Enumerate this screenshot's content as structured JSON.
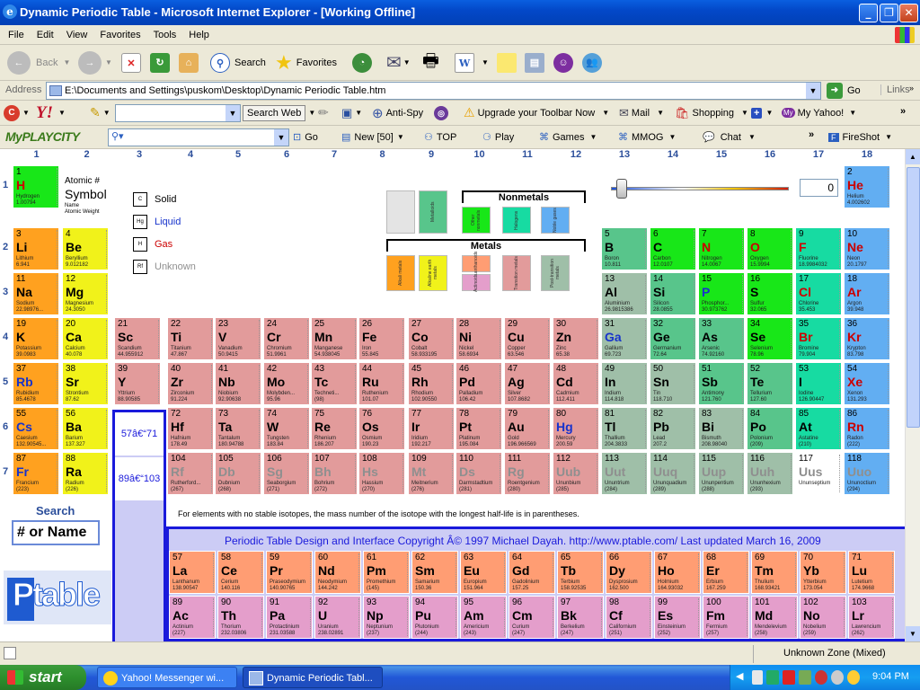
{
  "window": {
    "title": "Dynamic Periodic Table - Microsoft Internet Explorer - [Working Offline]"
  },
  "menu": [
    "File",
    "Edit",
    "View",
    "Favorites",
    "Tools",
    "Help"
  ],
  "toolbar": {
    "back": "Back",
    "search": "Search",
    "favorites": "Favorites"
  },
  "address": {
    "label": "Address",
    "value": "E:\\Documents and Settings\\puskom\\Desktop\\Dynamic Periodic Table.htm",
    "go": "Go",
    "links": "Links"
  },
  "yahoo_bar": {
    "search_web": "Search Web",
    "anti_spy": "Anti-Spy",
    "upgrade": "Upgrade your Toolbar Now",
    "mail": "Mail",
    "shopping": "Shopping",
    "my_yahoo": "My Yahoo!"
  },
  "myplaycity_bar": {
    "logo": "MyPLAYCITY",
    "go": "Go",
    "new": "New [50]",
    "top": "TOP",
    "play": "Play",
    "games": "Games",
    "mmog": "MMOG",
    "chat": "Chat",
    "fireshot": "FireShot"
  },
  "columns": [
    "1",
    "2",
    "3",
    "4",
    "5",
    "6",
    "7",
    "8",
    "9",
    "10",
    "11",
    "12",
    "13",
    "14",
    "15",
    "16",
    "17",
    "18"
  ],
  "rows": [
    "1",
    "2",
    "3",
    "4",
    "5",
    "6",
    "7"
  ],
  "key": {
    "atomic_no": "Atomic #",
    "symbol": "Symbol",
    "name": "Name",
    "weight": "Atomic Weight"
  },
  "states": [
    {
      "code": "C",
      "label": "Solid",
      "color": "#000000"
    },
    {
      "code": "Hg",
      "label": "Liquid",
      "color": "#1733cc"
    },
    {
      "code": "H",
      "label": "Gas",
      "color": "#cc0000"
    },
    {
      "code": "Rf",
      "label": "Unknown",
      "color": "#8f8f8f"
    }
  ],
  "categories": {
    "nonmetals": "Nonmetals",
    "metals": "Metals"
  },
  "temperature": {
    "value": "0"
  },
  "lanthanide_range": "57â€“71",
  "actinide_range": "89â€“103",
  "note": "For elements with no stable isotopes, the mass number of the isotope with the longest half-life is in parentheses.",
  "copyright": "Periodic Table Design and Interface Copyright Â© 1997 Michael Dayah. http://www.ptable.com/ Last updated March 16, 2009",
  "search": {
    "title": "Search",
    "placeholder": "# or Name"
  },
  "logo": {
    "big": "Ptable",
    ".com": ".com"
  },
  "statusbar": {
    "zone": "Unknown Zone (Mixed)"
  },
  "taskbar": {
    "start": "start",
    "tasks": [
      "Yahoo! Messenger wi...",
      "Dynamic Periodic Tabl..."
    ],
    "clock": "9:04 PM"
  },
  "elements": [
    {
      "n": 1,
      "s": "H",
      "name": "Hydrogen",
      "w": "1.00794",
      "c": "nm",
      "st": "gas",
      "col": 1,
      "row": 1
    },
    {
      "n": 2,
      "s": "He",
      "name": "Helium",
      "w": "4.002602",
      "c": "ng",
      "st": "gas",
      "col": 18,
      "row": 1
    },
    {
      "n": 3,
      "s": "Li",
      "name": "Lithium",
      "w": "6.941",
      "c": "alk",
      "st": "solid",
      "col": 1,
      "row": 2
    },
    {
      "n": 4,
      "s": "Be",
      "name": "Beryllium",
      "w": "9.012182",
      "c": "ae",
      "st": "solid",
      "col": 2,
      "row": 2
    },
    {
      "n": 5,
      "s": "B",
      "name": "Boron",
      "w": "10.811",
      "c": "met",
      "st": "solid",
      "col": 13,
      "row": 2
    },
    {
      "n": 6,
      "s": "C",
      "name": "Carbon",
      "w": "12.0107",
      "c": "nm",
      "st": "solid",
      "col": 14,
      "row": 2
    },
    {
      "n": 7,
      "s": "N",
      "name": "Nitrogen",
      "w": "14.0067",
      "c": "nm",
      "st": "gas",
      "col": 15,
      "row": 2
    },
    {
      "n": 8,
      "s": "O",
      "name": "Oxygen",
      "w": "15.9994",
      "c": "nm",
      "st": "gas",
      "col": 16,
      "row": 2
    },
    {
      "n": 9,
      "s": "F",
      "name": "Fluorine",
      "w": "18.9984032",
      "c": "hal",
      "st": "gas",
      "col": 17,
      "row": 2
    },
    {
      "n": 10,
      "s": "Ne",
      "name": "Neon",
      "w": "20.1797",
      "c": "ng",
      "st": "gas",
      "col": 18,
      "row": 2
    },
    {
      "n": 11,
      "s": "Na",
      "name": "Sodium",
      "w": "22.98976...",
      "c": "alk",
      "st": "solid",
      "col": 1,
      "row": 3
    },
    {
      "n": 12,
      "s": "Mg",
      "name": "Magnesium",
      "w": "24.3050",
      "c": "ae",
      "st": "solid",
      "col": 2,
      "row": 3
    },
    {
      "n": 13,
      "s": "Al",
      "name": "Aluminium",
      "w": "26.9815386",
      "c": "pt",
      "st": "solid",
      "col": 13,
      "row": 3
    },
    {
      "n": 14,
      "s": "Si",
      "name": "Silicon",
      "w": "28.0855",
      "c": "met",
      "st": "solid",
      "col": 14,
      "row": 3
    },
    {
      "n": 15,
      "s": "P",
      "name": "Phosphor...",
      "w": "30.973762",
      "c": "nm",
      "st": "liquid",
      "col": 15,
      "row": 3
    },
    {
      "n": 16,
      "s": "S",
      "name": "Sulfur",
      "w": "32.065",
      "c": "nm",
      "st": "solid",
      "col": 16,
      "row": 3
    },
    {
      "n": 17,
      "s": "Cl",
      "name": "Chlorine",
      "w": "35.453",
      "c": "hal",
      "st": "gas",
      "col": 17,
      "row": 3
    },
    {
      "n": 18,
      "s": "Ar",
      "name": "Argon",
      "w": "39.948",
      "c": "ng",
      "st": "gas",
      "col": 18,
      "row": 3
    },
    {
      "n": 19,
      "s": "K",
      "name": "Potassium",
      "w": "39.0983",
      "c": "alk",
      "st": "solid",
      "col": 1,
      "row": 4
    },
    {
      "n": 20,
      "s": "Ca",
      "name": "Calcium",
      "w": "40.078",
      "c": "ae",
      "st": "solid",
      "col": 2,
      "row": 4
    },
    {
      "n": 21,
      "s": "Sc",
      "name": "Scandium",
      "w": "44.955912",
      "c": "tm",
      "st": "solid",
      "col": 3,
      "row": 4
    },
    {
      "n": 22,
      "s": "Ti",
      "name": "Titanium",
      "w": "47.867",
      "c": "tm",
      "st": "solid",
      "col": 4,
      "row": 4
    },
    {
      "n": 23,
      "s": "V",
      "name": "Vanadium",
      "w": "50.9415",
      "c": "tm",
      "st": "solid",
      "col": 5,
      "row": 4
    },
    {
      "n": 24,
      "s": "Cr",
      "name": "Chromium",
      "w": "51.9961",
      "c": "tm",
      "st": "solid",
      "col": 6,
      "row": 4
    },
    {
      "n": 25,
      "s": "Mn",
      "name": "Manganese",
      "w": "54.938045",
      "c": "tm",
      "st": "solid",
      "col": 7,
      "row": 4
    },
    {
      "n": 26,
      "s": "Fe",
      "name": "Iron",
      "w": "55.845",
      "c": "tm",
      "st": "solid",
      "col": 8,
      "row": 4
    },
    {
      "n": 27,
      "s": "Co",
      "name": "Cobalt",
      "w": "58.933195",
      "c": "tm",
      "st": "solid",
      "col": 9,
      "row": 4
    },
    {
      "n": 28,
      "s": "Ni",
      "name": "Nickel",
      "w": "58.6934",
      "c": "tm",
      "st": "solid",
      "col": 10,
      "row": 4
    },
    {
      "n": 29,
      "s": "Cu",
      "name": "Copper",
      "w": "63.546",
      "c": "tm",
      "st": "solid",
      "col": 11,
      "row": 4
    },
    {
      "n": 30,
      "s": "Zn",
      "name": "Zinc",
      "w": "65.38",
      "c": "tm",
      "st": "solid",
      "col": 12,
      "row": 4
    },
    {
      "n": 31,
      "s": "Ga",
      "name": "Gallium",
      "w": "69.723",
      "c": "pt",
      "st": "liquid",
      "col": 13,
      "row": 4
    },
    {
      "n": 32,
      "s": "Ge",
      "name": "Germanium",
      "w": "72.64",
      "c": "met",
      "st": "solid",
      "col": 14,
      "row": 4
    },
    {
      "n": 33,
      "s": "As",
      "name": "Arsenic",
      "w": "74.92160",
      "c": "met",
      "st": "solid",
      "col": 15,
      "row": 4
    },
    {
      "n": 34,
      "s": "Se",
      "name": "Selenium",
      "w": "78.96",
      "c": "nm",
      "st": "solid",
      "col": 16,
      "row": 4
    },
    {
      "n": 35,
      "s": "Br",
      "name": "Bromine",
      "w": "79.904",
      "c": "hal",
      "st": "gas",
      "col": 17,
      "row": 4
    },
    {
      "n": 36,
      "s": "Kr",
      "name": "Krypton",
      "w": "83.798",
      "c": "ng",
      "st": "gas",
      "col": 18,
      "row": 4
    },
    {
      "n": 37,
      "s": "Rb",
      "name": "Rubidium",
      "w": "85.4678",
      "c": "alk",
      "st": "liquid",
      "col": 1,
      "row": 5
    },
    {
      "n": 38,
      "s": "Sr",
      "name": "Strontium",
      "w": "87.62",
      "c": "ae",
      "st": "solid",
      "col": 2,
      "row": 5
    },
    {
      "n": 39,
      "s": "Y",
      "name": "Yttrium",
      "w": "88.90585",
      "c": "tm",
      "st": "solid",
      "col": 3,
      "row": 5
    },
    {
      "n": 40,
      "s": "Zr",
      "name": "Zirconium",
      "w": "91.224",
      "c": "tm",
      "st": "solid",
      "col": 4,
      "row": 5
    },
    {
      "n": 41,
      "s": "Nb",
      "name": "Niobium",
      "w": "92.90638",
      "c": "tm",
      "st": "solid",
      "col": 5,
      "row": 5
    },
    {
      "n": 42,
      "s": "Mo",
      "name": "Molybden...",
      "w": "95.96",
      "c": "tm",
      "st": "solid",
      "col": 6,
      "row": 5
    },
    {
      "n": 43,
      "s": "Tc",
      "name": "Techneti...",
      "w": "(98)",
      "c": "tm",
      "st": "solid",
      "col": 7,
      "row": 5
    },
    {
      "n": 44,
      "s": "Ru",
      "name": "Ruthenium",
      "w": "101.07",
      "c": "tm",
      "st": "solid",
      "col": 8,
      "row": 5
    },
    {
      "n": 45,
      "s": "Rh",
      "name": "Rhodium",
      "w": "102.90550",
      "c": "tm",
      "st": "solid",
      "col": 9,
      "row": 5
    },
    {
      "n": 46,
      "s": "Pd",
      "name": "Palladium",
      "w": "106.42",
      "c": "tm",
      "st": "solid",
      "col": 10,
      "row": 5
    },
    {
      "n": 47,
      "s": "Ag",
      "name": "Silver",
      "w": "107.8682",
      "c": "tm",
      "st": "solid",
      "col": 11,
      "row": 5
    },
    {
      "n": 48,
      "s": "Cd",
      "name": "Cadmium",
      "w": "112.411",
      "c": "tm",
      "st": "solid",
      "col": 12,
      "row": 5
    },
    {
      "n": 49,
      "s": "In",
      "name": "Indium",
      "w": "114.818",
      "c": "pt",
      "st": "solid",
      "col": 13,
      "row": 5
    },
    {
      "n": 50,
      "s": "Sn",
      "name": "Tin",
      "w": "118.710",
      "c": "pt",
      "st": "solid",
      "col": 14,
      "row": 5
    },
    {
      "n": 51,
      "s": "Sb",
      "name": "Antimony",
      "w": "121.760",
      "c": "met",
      "st": "solid",
      "col": 15,
      "row": 5
    },
    {
      "n": 52,
      "s": "Te",
      "name": "Tellurium",
      "w": "127.60",
      "c": "met",
      "st": "solid",
      "col": 16,
      "row": 5
    },
    {
      "n": 53,
      "s": "I",
      "name": "Iodine",
      "w": "126.90447",
      "c": "hal",
      "st": "solid",
      "col": 17,
      "row": 5
    },
    {
      "n": 54,
      "s": "Xe",
      "name": "Xenon",
      "w": "131.293",
      "c": "ng",
      "st": "gas",
      "col": 18,
      "row": 5
    },
    {
      "n": 55,
      "s": "Cs",
      "name": "Caesium",
      "w": "132.90545...",
      "c": "alk",
      "st": "liquid",
      "col": 1,
      "row": 6
    },
    {
      "n": 56,
      "s": "Ba",
      "name": "Barium",
      "w": "137.327",
      "c": "ae",
      "st": "solid",
      "col": 2,
      "row": 6
    },
    {
      "n": 72,
      "s": "Hf",
      "name": "Hafnium",
      "w": "178.49",
      "c": "tm",
      "st": "solid",
      "col": 4,
      "row": 6
    },
    {
      "n": 73,
      "s": "Ta",
      "name": "Tantalum",
      "w": "180.94788",
      "c": "tm",
      "st": "solid",
      "col": 5,
      "row": 6
    },
    {
      "n": 74,
      "s": "W",
      "name": "Tungsten",
      "w": "183.84",
      "c": "tm",
      "st": "solid",
      "col": 6,
      "row": 6
    },
    {
      "n": 75,
      "s": "Re",
      "name": "Rhenium",
      "w": "186.207",
      "c": "tm",
      "st": "solid",
      "col": 7,
      "row": 6
    },
    {
      "n": 76,
      "s": "Os",
      "name": "Osmium",
      "w": "190.23",
      "c": "tm",
      "st": "solid",
      "col": 8,
      "row": 6
    },
    {
      "n": 77,
      "s": "Ir",
      "name": "Iridium",
      "w": "192.217",
      "c": "tm",
      "st": "solid",
      "col": 9,
      "row": 6
    },
    {
      "n": 78,
      "s": "Pt",
      "name": "Platinum",
      "w": "195.084",
      "c": "tm",
      "st": "solid",
      "col": 10,
      "row": 6
    },
    {
      "n": 79,
      "s": "Au",
      "name": "Gold",
      "w": "196.966569",
      "c": "tm",
      "st": "solid",
      "col": 11,
      "row": 6
    },
    {
      "n": 80,
      "s": "Hg",
      "name": "Mercury",
      "w": "200.59",
      "c": "tm",
      "st": "liquid",
      "col": 12,
      "row": 6
    },
    {
      "n": 81,
      "s": "Tl",
      "name": "Thallium",
      "w": "204.3833",
      "c": "pt",
      "st": "solid",
      "col": 13,
      "row": 6
    },
    {
      "n": 82,
      "s": "Pb",
      "name": "Lead",
      "w": "207.2",
      "c": "pt",
      "st": "solid",
      "col": 14,
      "row": 6
    },
    {
      "n": 83,
      "s": "Bi",
      "name": "Bismuth",
      "w": "208.98040",
      "c": "pt",
      "st": "solid",
      "col": 15,
      "row": 6
    },
    {
      "n": 84,
      "s": "Po",
      "name": "Polonium",
      "w": "(209)",
      "c": "met",
      "st": "solid",
      "col": 16,
      "row": 6
    },
    {
      "n": 85,
      "s": "At",
      "name": "Astatine",
      "w": "(210)",
      "c": "hal",
      "st": "solid",
      "col": 17,
      "row": 6
    },
    {
      "n": 86,
      "s": "Rn",
      "name": "Radon",
      "w": "(222)",
      "c": "ng",
      "st": "gas",
      "col": 18,
      "row": 6
    },
    {
      "n": 87,
      "s": "Fr",
      "name": "Francium",
      "w": "(223)",
      "c": "alk",
      "st": "liquid",
      "col": 1,
      "row": 7
    },
    {
      "n": 88,
      "s": "Ra",
      "name": "Radium",
      "w": "(226)",
      "c": "ae",
      "st": "solid",
      "col": 2,
      "row": 7
    },
    {
      "n": 104,
      "s": "Rf",
      "name": "Rutherford...",
      "w": "(267)",
      "c": "tm",
      "st": "unknown",
      "col": 4,
      "row": 7
    },
    {
      "n": 105,
      "s": "Db",
      "name": "Dubnium",
      "w": "(268)",
      "c": "tm",
      "st": "unknown",
      "col": 5,
      "row": 7
    },
    {
      "n": 106,
      "s": "Sg",
      "name": "Seaborgium",
      "w": "(271)",
      "c": "tm",
      "st": "unknown",
      "col": 6,
      "row": 7
    },
    {
      "n": 107,
      "s": "Bh",
      "name": "Bohrium",
      "w": "(272)",
      "c": "tm",
      "st": "unknown",
      "col": 7,
      "row": 7
    },
    {
      "n": 108,
      "s": "Hs",
      "name": "Hassium",
      "w": "(270)",
      "c": "tm",
      "st": "unknown",
      "col": 8,
      "row": 7
    },
    {
      "n": 109,
      "s": "Mt",
      "name": "Meitnerium",
      "w": "(276)",
      "c": "tm",
      "st": "unknown",
      "col": 9,
      "row": 7
    },
    {
      "n": 110,
      "s": "Ds",
      "name": "Darmstadtium",
      "w": "(281)",
      "c": "tm",
      "st": "unknown",
      "col": 10,
      "row": 7
    },
    {
      "n": 111,
      "s": "Rg",
      "name": "Roentgenium",
      "w": "(280)",
      "c": "tm",
      "st": "unknown",
      "col": 11,
      "row": 7
    },
    {
      "n": 112,
      "s": "Uub",
      "name": "Ununbium",
      "w": "(285)",
      "c": "tm",
      "st": "unknown",
      "col": 12,
      "row": 7
    },
    {
      "n": 113,
      "s": "Uut",
      "name": "Ununtrium",
      "w": "(284)",
      "c": "pt",
      "st": "unknown",
      "col": 13,
      "row": 7
    },
    {
      "n": 114,
      "s": "Uuq",
      "name": "Ununquadium",
      "w": "(289)",
      "c": "pt",
      "st": "unknown",
      "col": 14,
      "row": 7
    },
    {
      "n": 115,
      "s": "Uup",
      "name": "Ununpentium",
      "w": "(288)",
      "c": "pt",
      "st": "unknown",
      "col": 15,
      "row": 7
    },
    {
      "n": 116,
      "s": "Uuh",
      "name": "Ununhexium",
      "w": "(293)",
      "c": "pt",
      "st": "unknown",
      "col": 16,
      "row": 7
    },
    {
      "n": 117,
      "s": "Uus",
      "name": "Ununseptium",
      "w": "",
      "c": "un",
      "st": "unknown",
      "col": 17,
      "row": 7
    },
    {
      "n": 118,
      "s": "Uuo",
      "name": "Ununoctium",
      "w": "(294)",
      "c": "ng",
      "st": "unknown",
      "col": 18,
      "row": 7
    }
  ],
  "lanthanides": [
    {
      "n": 57,
      "s": "La",
      "name": "Lanthanum",
      "w": "138.90547"
    },
    {
      "n": 58,
      "s": "Ce",
      "name": "Cerium",
      "w": "140.116"
    },
    {
      "n": 59,
      "s": "Pr",
      "name": "Praseodymium",
      "w": "140.90765"
    },
    {
      "n": 60,
      "s": "Nd",
      "name": "Neodymium",
      "w": "144.242"
    },
    {
      "n": 61,
      "s": "Pm",
      "name": "Promethium",
      "w": "(145)"
    },
    {
      "n": 62,
      "s": "Sm",
      "name": "Samarium",
      "w": "150.36"
    },
    {
      "n": 63,
      "s": "Eu",
      "name": "Europium",
      "w": "151.964"
    },
    {
      "n": 64,
      "s": "Gd",
      "name": "Gadolinium",
      "w": "157.25"
    },
    {
      "n": 65,
      "s": "Tb",
      "name": "Terbium",
      "w": "158.92535"
    },
    {
      "n": 66,
      "s": "Dy",
      "name": "Dysprosium",
      "w": "162.500"
    },
    {
      "n": 67,
      "s": "Ho",
      "name": "Holmium",
      "w": "164.93032"
    },
    {
      "n": 68,
      "s": "Er",
      "name": "Erbium",
      "w": "167.259"
    },
    {
      "n": 69,
      "s": "Tm",
      "name": "Thulium",
      "w": "168.93421"
    },
    {
      "n": 70,
      "s": "Yb",
      "name": "Ytterbium",
      "w": "173.054"
    },
    {
      "n": 71,
      "s": "Lu",
      "name": "Lutetium",
      "w": "174.9668"
    }
  ],
  "actinides": [
    {
      "n": 89,
      "s": "Ac",
      "name": "Actinium",
      "w": "(227)"
    },
    {
      "n": 90,
      "s": "Th",
      "name": "Thorium",
      "w": "232.03806"
    },
    {
      "n": 91,
      "s": "Pa",
      "name": "Protactinium",
      "w": "231.03588"
    },
    {
      "n": 92,
      "s": "U",
      "name": "Uranium",
      "w": "238.02891"
    },
    {
      "n": 93,
      "s": "Np",
      "name": "Neptunium",
      "w": "(237)"
    },
    {
      "n": 94,
      "s": "Pu",
      "name": "Plutonium",
      "w": "(244)"
    },
    {
      "n": 95,
      "s": "Am",
      "name": "Americium",
      "w": "(243)"
    },
    {
      "n": 96,
      "s": "Cm",
      "name": "Curium",
      "w": "(247)"
    },
    {
      "n": 97,
      "s": "Bk",
      "name": "Berkelium",
      "w": "(247)"
    },
    {
      "n": 98,
      "s": "Cf",
      "name": "Californium",
      "w": "(251)"
    },
    {
      "n": 99,
      "s": "Es",
      "name": "Einsteinium",
      "w": "(252)"
    },
    {
      "n": 100,
      "s": "Fm",
      "name": "Fermium",
      "w": "(257)"
    },
    {
      "n": 101,
      "s": "Md",
      "name": "Mendelevium",
      "w": "(258)"
    },
    {
      "n": 102,
      "s": "No",
      "name": "Nobelium",
      "w": "(259)"
    },
    {
      "n": 103,
      "s": "Lr",
      "name": "Lawrencium",
      "w": "(262)"
    }
  ]
}
